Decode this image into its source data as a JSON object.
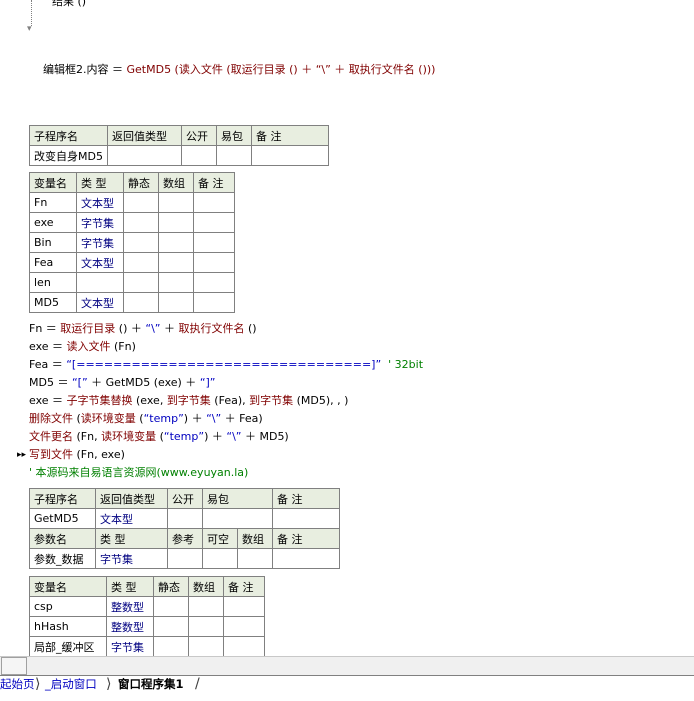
{
  "top_fragment": "结果 ()",
  "assign_line": {
    "lhs": "编辑框2.内容 ＝ ",
    "fn": "GetMD5 (读入文件 (取运行目录 () ＋ “\\” ＋ 取执行文件名 ()))"
  },
  "sub1": {
    "headers": [
      "子程序名",
      "返回值类型",
      "公开",
      "易包",
      "备 注"
    ],
    "row": [
      "改变自身MD5",
      "",
      "",
      "",
      ""
    ]
  },
  "vars1": {
    "headers": [
      "变量名",
      "类 型",
      "静态",
      "数组",
      "备 注"
    ],
    "rows": [
      [
        "Fn",
        "文本型",
        "",
        "",
        ""
      ],
      [
        "exe",
        "字节集",
        "",
        "",
        ""
      ],
      [
        "Bin",
        "字节集",
        "",
        "",
        ""
      ],
      [
        "Fea",
        "文本型",
        "",
        "",
        ""
      ],
      [
        "len",
        "",
        "",
        "",
        ""
      ],
      [
        "MD5",
        "文本型",
        "",
        "",
        ""
      ]
    ]
  },
  "code": [
    {
      "parts": [
        {
          "t": "Fn ＝ ",
          "c": "op"
        },
        {
          "t": "取运行目录",
          "c": "fn"
        },
        {
          "t": " () ＋ ",
          "c": "op"
        },
        {
          "t": "“\\”",
          "c": "str"
        },
        {
          "t": " ＋ ",
          "c": "op"
        },
        {
          "t": "取执行文件名",
          "c": "fn"
        },
        {
          "t": " ()",
          "c": "op"
        }
      ]
    },
    {
      "parts": [
        {
          "t": "exe ＝ ",
          "c": "op"
        },
        {
          "t": "读入文件",
          "c": "fn"
        },
        {
          "t": " (Fn)",
          "c": "op"
        }
      ]
    },
    {
      "parts": [
        {
          "t": "Fea ＝ ",
          "c": "op"
        },
        {
          "t": "“[================================]”",
          "c": "str"
        },
        {
          "t": "  ' 32bit",
          "c": "cm"
        }
      ]
    },
    {
      "parts": [
        {
          "t": "MD5 ＝ ",
          "c": "op"
        },
        {
          "t": "“[”",
          "c": "str"
        },
        {
          "t": " ＋ GetMD5 (exe) ＋ ",
          "c": "op"
        },
        {
          "t": "“]”",
          "c": "str"
        }
      ]
    },
    {
      "parts": [
        {
          "t": "exe ＝ ",
          "c": "op"
        },
        {
          "t": "子字节集替换",
          "c": "fn"
        },
        {
          "t": " (exe, ",
          "c": "op"
        },
        {
          "t": "到字节集",
          "c": "fn"
        },
        {
          "t": " (Fea), ",
          "c": "op"
        },
        {
          "t": "到字节集",
          "c": "fn"
        },
        {
          "t": " (MD5), , )",
          "c": "op"
        }
      ]
    },
    {
      "parts": [
        {
          "t": "删除文件",
          "c": "fn"
        },
        {
          "t": " (",
          "c": "op"
        },
        {
          "t": "读环境变量",
          "c": "fn"
        },
        {
          "t": " (",
          "c": "op"
        },
        {
          "t": "“temp”",
          "c": "str"
        },
        {
          "t": ") ＋ ",
          "c": "op"
        },
        {
          "t": "“\\”",
          "c": "str"
        },
        {
          "t": " ＋ Fea)",
          "c": "op"
        }
      ]
    },
    {
      "parts": [
        {
          "t": "文件更名",
          "c": "fn"
        },
        {
          "t": " (Fn, ",
          "c": "op"
        },
        {
          "t": "读环境变量",
          "c": "fn"
        },
        {
          "t": " (",
          "c": "op"
        },
        {
          "t": "“temp”",
          "c": "str"
        },
        {
          "t": ") ＋ ",
          "c": "op"
        },
        {
          "t": "“\\”",
          "c": "str"
        },
        {
          "t": " ＋ MD5)",
          "c": "op"
        }
      ]
    },
    {
      "parts": [
        {
          "t": "写到文件",
          "c": "fn"
        },
        {
          "t": " (Fn, exe)",
          "c": "op"
        }
      ]
    },
    {
      "parts": [
        {
          "t": "' 本源码来自易语言资源网(www.eyuyan.la)",
          "c": "cm"
        }
      ]
    }
  ],
  "sub2": {
    "headers": [
      "子程序名",
      "返回值类型",
      "公开",
      "易包",
      "备 注"
    ],
    "row": [
      "GetMD5",
      "文本型",
      "",
      "",
      ""
    ],
    "param_headers": [
      "参数名",
      "类 型",
      "参考",
      "可空",
      "数组",
      "备 注"
    ],
    "param_row": [
      "参数_数据",
      "字节集",
      "",
      "",
      "",
      ""
    ]
  },
  "vars2": {
    "headers": [
      "变量名",
      "类 型",
      "静态",
      "数组",
      "备 注"
    ],
    "rows": [
      [
        "csp",
        "整数型",
        "",
        "",
        ""
      ],
      [
        "hHash",
        "整数型",
        "",
        "",
        ""
      ],
      [
        "局部_缓冲区",
        "字节集",
        "",
        "",
        ""
      ]
    ]
  },
  "tabs": [
    "起始页",
    "_启动窗口",
    "窗口程序集1"
  ],
  "icons": {
    "marker": "breakpoint-arrow-icon",
    "hscroll": "scroll-button-icon"
  }
}
